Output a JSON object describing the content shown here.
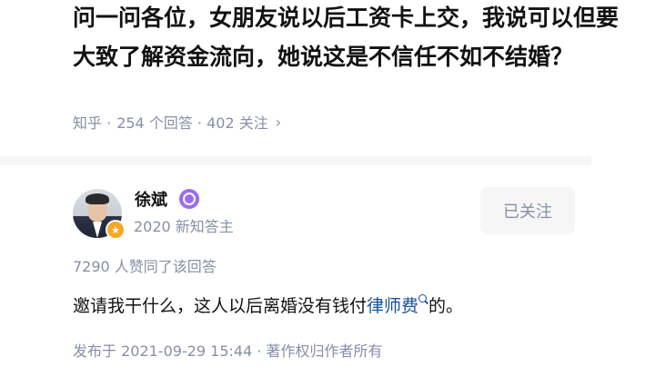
{
  "question": {
    "title": "问一问各位，女朋友说以后工资卡上交，我说可以但要大致了解资金流向，她说这是不信任不如不结婚？",
    "meta_prefix": "知乎 · ",
    "answer_count": "254",
    "answer_count_suffix": " 个回答 · ",
    "follower_count": "402",
    "follower_suffix": " 关注",
    "chevron": "›"
  },
  "author": {
    "name": "徐斌",
    "description": "2020 新知答主",
    "follow_label": "已关注",
    "avatar_icon": "person-avatar",
    "badge_icon": "gold-badge-icon",
    "verify_icon": "purple-verified-icon"
  },
  "answer": {
    "likes_text": "7290 人赞同了该回答",
    "text_before": "邀请我干什么，这人以后离婚没有钱付",
    "link_text": "律师费",
    "text_after": "的。",
    "publish_text": "发布于 2021-09-29 15:44 · 著作权归作者所有"
  },
  "colors": {
    "title": "#121212",
    "meta": "#8590a6",
    "link": "#175199",
    "verify": "#9a6cf0",
    "badge": "#f7a823",
    "follow_bg": "#f6f6f6"
  }
}
